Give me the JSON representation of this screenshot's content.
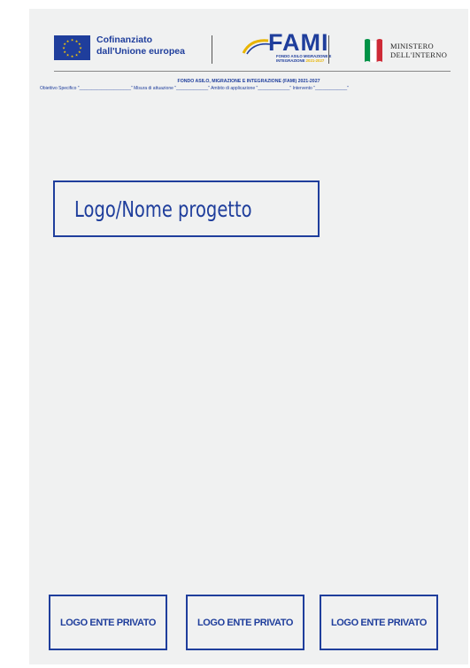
{
  "header": {
    "eu_logo": {
      "line1": "Cofinanziato",
      "line2": "dall'Unione europea",
      "icon": "eu-flag-icon"
    },
    "fami_logo": {
      "word": "FAMI",
      "sub_line1": "FONDO ASILO MIGRAZIONE E",
      "sub_line2_a": "INTEGRAZIONE ",
      "sub_line2_b": "2021-2027",
      "icon": "fami-swoosh-icon"
    },
    "ministero_logo": {
      "line1": "MINISTERO",
      "line2": "DELL'INTERNO",
      "icon": "italian-flag-icon"
    }
  },
  "fondo": {
    "title": "FONDO ASILO, MIGRAZIONE E INTEGRAZIONE (FAMI) 2021-2027",
    "fields": "Obiettivo Specifico \"_____________________\" Misura di attuazione \"_____________\" Ambito di applicazione \"_____________\" Intervento \"_____________\""
  },
  "project": {
    "label": "Logo/Nome progetto"
  },
  "enti": [
    {
      "label": "LOGO ENTE PRIVATO"
    },
    {
      "label": "LOGO ENTE PRIVATO"
    },
    {
      "label": "LOGO ENTE PRIVATO"
    }
  ],
  "colors": {
    "brand_blue": "#1f3e9c",
    "page_background": "#f0f1f1",
    "fami_yellow": "#e8b400",
    "italy_green": "#009246",
    "italy_red": "#ce2b37"
  }
}
